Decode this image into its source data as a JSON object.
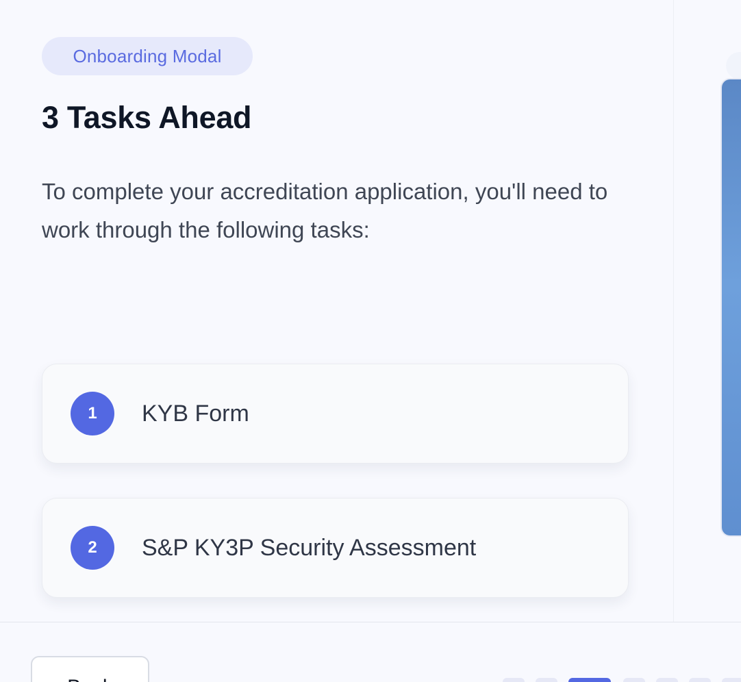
{
  "modal": {
    "tag": "Onboarding Modal",
    "title": "3 Tasks Ahead",
    "intro": "To complete your accreditation application, you'll need to work through the following tasks:"
  },
  "tasks": [
    {
      "number": "1",
      "label": "KYB Form"
    },
    {
      "number": "2",
      "label": "S&P KY3P Security Assessment"
    }
  ],
  "footer": {
    "back_label": "Back"
  },
  "stepper": {
    "total_visible": 8,
    "active_index": 2
  },
  "colors": {
    "accent": "#5368e2",
    "tag_bg": "#e6e9fb",
    "tag_text": "#5a6be0",
    "page_bg": "#f8f9fe",
    "title": "#0f1726"
  }
}
